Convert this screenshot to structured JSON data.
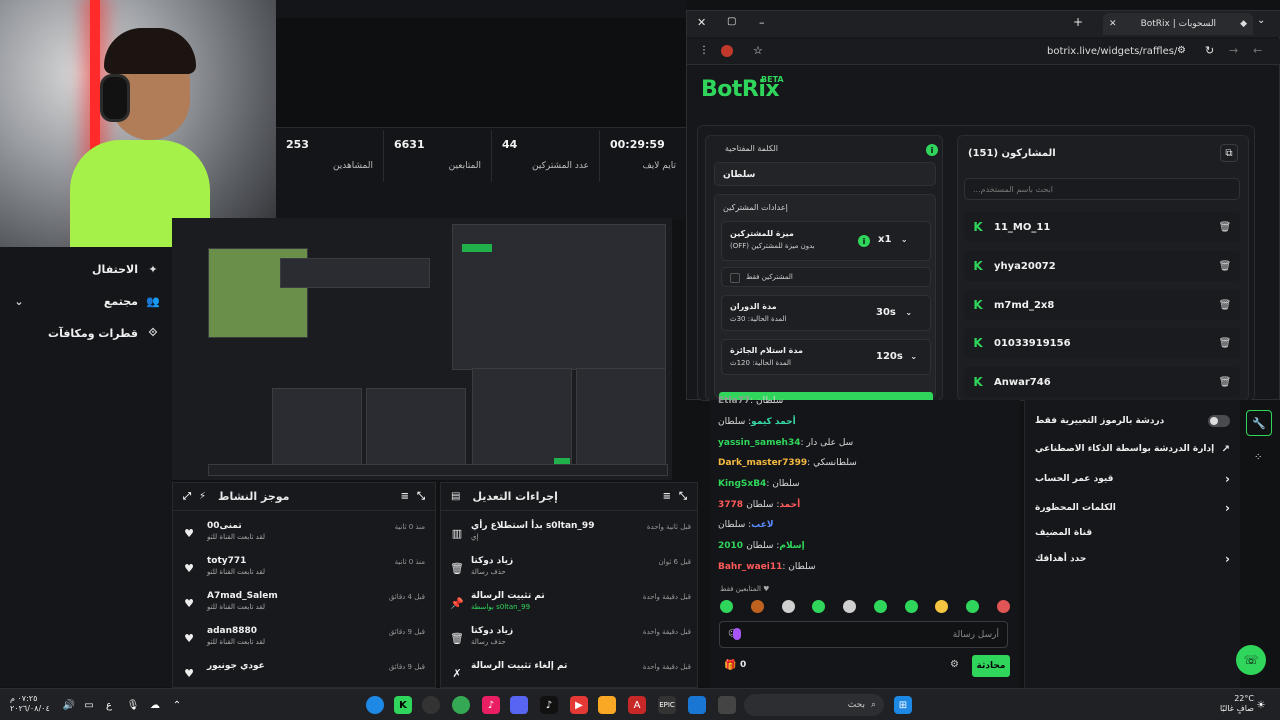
{
  "colors": {
    "accent": "#2fd65b",
    "bg": "#111214",
    "panel": "#18191c"
  },
  "leftnav": {
    "items": [
      {
        "label": "الاحتفال",
        "icon": "party-icon"
      },
      {
        "label": "مجتمع",
        "icon": "community-icon"
      },
      {
        "label": "قطرات ومكافآت",
        "icon": "drops-icon"
      }
    ]
  },
  "stats": [
    {
      "value": "253",
      "label": "المشاهدين"
    },
    {
      "value": "6631",
      "label": "المتابعين"
    },
    {
      "value": "44",
      "label": "عدد المشتركين"
    },
    {
      "value": "00:29:59",
      "label": "تايم لايف"
    }
  ],
  "browser": {
    "tab_title": "BotRix | السحوبات",
    "url": "botrix.live/widgets/raffles/",
    "logo": "BotRix",
    "beta": "BETA"
  },
  "raffle": {
    "keyword_label": "الكلمة المفتاحية",
    "keyword_value": "سلطان",
    "subs_settings_label": "إعدادات المشتركين",
    "sub_bonus_title": "ميزة للمشتركين",
    "sub_bonus_desc": "بدون ميزة للمشتركين (OFF)",
    "sub_bonus_value": "x1",
    "subs_only_label": "المشتركين فقط",
    "duration_title": "مدة الدوران",
    "duration_desc": "المدة الحالية: 30ث",
    "duration_value": "30s",
    "claim_title": "مدة استلام الجائزة",
    "claim_desc": "المدة الحالية: 120ث",
    "claim_value": "120s"
  },
  "participants": {
    "title": "المشاركون (151)",
    "search_placeholder": "ابحث باسم المستخدم...",
    "items": [
      "11_MO_11",
      "yhya20072",
      "m7md_2x8",
      "01033919156",
      "Anwar746"
    ]
  },
  "activity_feed": {
    "title": "موجز النشاط",
    "items": [
      {
        "name": "0تمنى0",
        "desc": "لقد تابعت القناة للتو",
        "time": "منذ 0 ثانية"
      },
      {
        "name": "toty771",
        "desc": "لقد تابعت القناة للتو",
        "time": "منذ 0 ثانية"
      },
      {
        "name": "A7mad_Salem",
        "desc": "لقد تابعت القناة للتو",
        "time": "قبل 4 دقائق"
      },
      {
        "name": "adan8880",
        "desc": "لقد تابعت القناة للتو",
        "time": "قبل 9 دقائق"
      },
      {
        "name": "عودي جونيور",
        "desc": "",
        "time": "قبل 9 دقائق"
      }
    ]
  },
  "mod_actions": {
    "title": "إجراءات التعديل",
    "items": [
      {
        "name": "بدأ استطلاع رأي s0ltan_99",
        "desc": "إي",
        "time": "قبل ثانية واحدة",
        "icon": "poll-icon"
      },
      {
        "name": "زياد دوكتا",
        "desc": "حذف رسالة",
        "time": "قبل 6 ثوان",
        "icon": "trash-icon"
      },
      {
        "name": "تم تثبيت الرسالة",
        "desc": "بواسطة s0ltan_99",
        "time": "قبل دقيقة واحدة",
        "icon": "pin-icon"
      },
      {
        "name": "زياد دوكتا",
        "desc": "حذف رسالة",
        "time": "قبل دقيقة واحدة",
        "icon": "trash-icon"
      },
      {
        "name": "تم إلغاء تثبيت الرسالة",
        "desc": "",
        "time": "قبل دقيقة واحدة",
        "icon": "unpin-icon"
      }
    ]
  },
  "chat": {
    "messages": [
      {
        "user": "Etla77",
        "text": "سلطان",
        "color": "#9a9a9a"
      },
      {
        "user": "أحمد كيمو",
        "text": "سلطان",
        "color": "#38d9a9"
      },
      {
        "user": "yassin_sameh34",
        "text": "سل على دار",
        "color": "#2fd65b"
      },
      {
        "user": "Dark_master7399",
        "text": "سلطانسكي",
        "color": "#f5b942"
      },
      {
        "user": "KingSxB4",
        "text": "سلطان",
        "color": "#2fd65b"
      },
      {
        "user": "3778 أحمد",
        "text": "سلطان",
        "color": "#ff5a5a"
      },
      {
        "user": "لاعب",
        "text": "سلطان",
        "color": "#5a8bff"
      },
      {
        "user": "2010 إسلام",
        "text": "سلطان",
        "color": "#2fd65b"
      },
      {
        "user": "Bahr_waei11",
        "text": "سلطان",
        "color": "#ff5a5a"
      }
    ],
    "followers_only": "المتابعين فقط",
    "input_placeholder": "أرسل رسالة",
    "send_label": "محادثة",
    "points": "0"
  },
  "settings": {
    "items": [
      {
        "label": "دردشة بالرموز التعبيرية فقط",
        "control": "toggle"
      },
      {
        "label": "إدارة الدردشة بواسطة الذكاء الاصطناعي",
        "control": "link"
      },
      {
        "label": "قيود عمر الحساب",
        "control": "chevron"
      },
      {
        "label": "الكلمات المحظورة",
        "control": "chevron"
      },
      {
        "label": "قناة المضيف",
        "control": "none"
      },
      {
        "label": "حدد أهدافك",
        "control": "chevron"
      }
    ]
  },
  "taskbar": {
    "time": "٠٧:٢٥ م",
    "date": "٢٠٢٦/٠٨/٠٤",
    "search": "بحث",
    "temp": "22°C",
    "weather": "صافٍ غالبًا"
  }
}
